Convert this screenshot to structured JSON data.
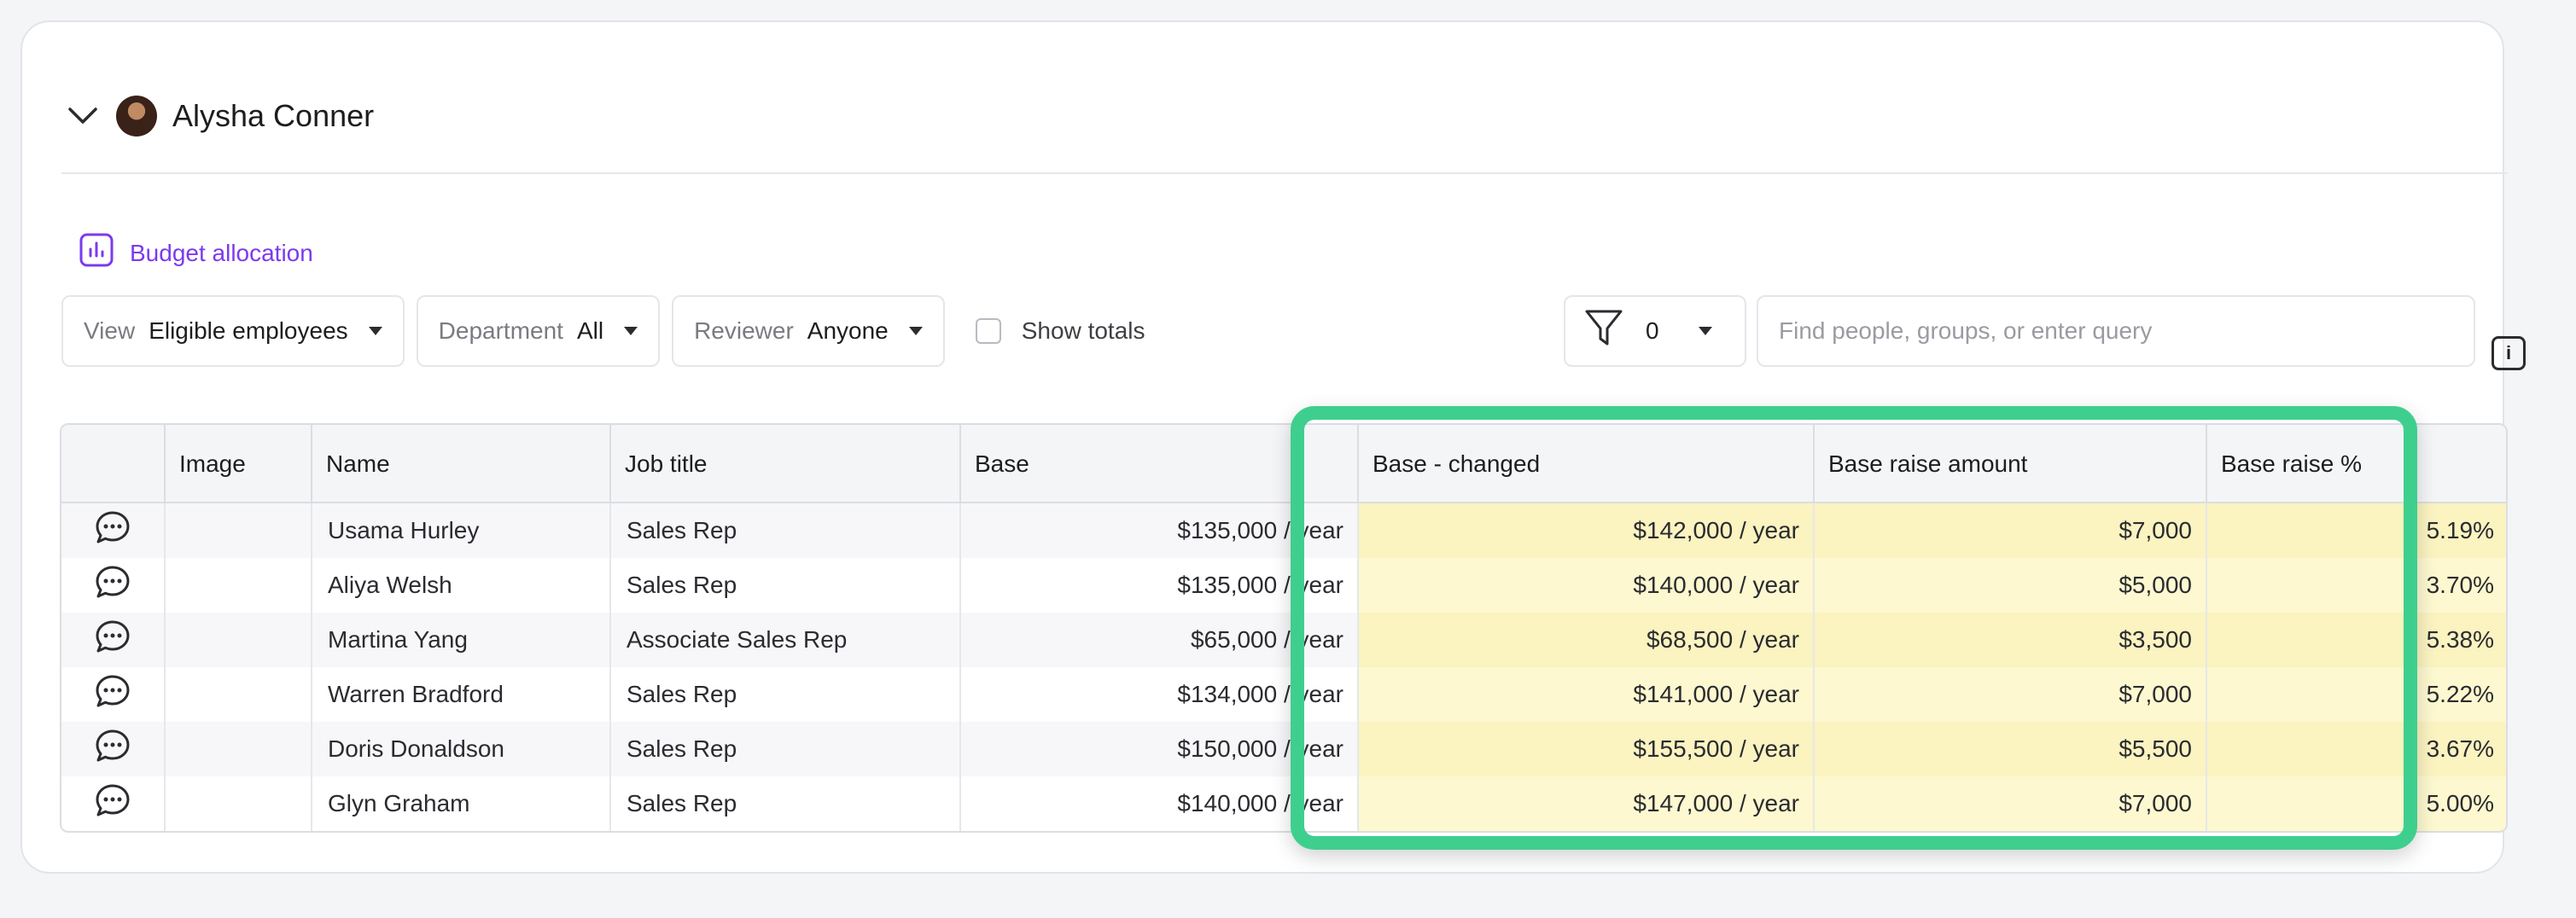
{
  "person": {
    "name": "Alysha Conner"
  },
  "budget": {
    "label": "Budget allocation"
  },
  "filters": {
    "view": {
      "label": "View",
      "value": "Eligible employees"
    },
    "department": {
      "label": "Department",
      "value": "All"
    },
    "reviewer": {
      "label": "Reviewer",
      "value": "Anyone"
    },
    "show_totals": "Show totals",
    "filter_count": "0"
  },
  "search": {
    "placeholder": "Find people, groups, or enter query"
  },
  "info_label": "i",
  "table": {
    "headers": {
      "image": "Image",
      "name": "Name",
      "job_title": "Job title",
      "base": "Base",
      "base_changed": "Base - changed",
      "raise_amount": "Base raise amount",
      "raise_pct": "Base raise %"
    },
    "rows": [
      {
        "name": "Usama Hurley",
        "job": "Sales Rep",
        "base": "$135,000 / year",
        "changed": "$142,000 / year",
        "amount": "$7,000",
        "pct": "5.19%"
      },
      {
        "name": "Aliya Welsh",
        "job": "Sales Rep",
        "base": "$135,000 / year",
        "changed": "$140,000 / year",
        "amount": "$5,000",
        "pct": "3.70%"
      },
      {
        "name": "Martina Yang",
        "job": "Associate Sales Rep",
        "base": "$65,000 / year",
        "changed": "$68,500 / year",
        "amount": "$3,500",
        "pct": "5.38%"
      },
      {
        "name": "Warren Bradford",
        "job": "Sales Rep",
        "base": "$134,000 / year",
        "changed": "$141,000 / year",
        "amount": "$7,000",
        "pct": "5.22%"
      },
      {
        "name": "Doris Donaldson",
        "job": "Sales Rep",
        "base": "$150,000 / year",
        "changed": "$155,500 / year",
        "amount": "$5,500",
        "pct": "3.67%"
      },
      {
        "name": "Glyn Graham",
        "job": "Sales Rep",
        "base": "$140,000 / year",
        "changed": "$147,000 / year",
        "amount": "$7,000",
        "pct": "5.00%"
      }
    ]
  },
  "colors": {
    "accent": "#7c3aed",
    "highlight": "#3ecf8e",
    "changed_bg": "#fdf8cf"
  }
}
